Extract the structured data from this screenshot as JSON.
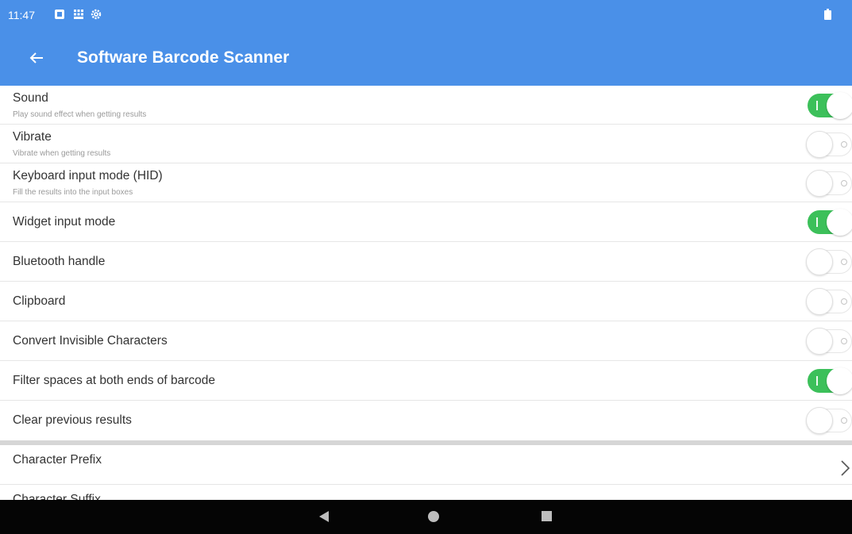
{
  "status_bar": {
    "time": "11:47",
    "icons": [
      "notification-icon",
      "grid-icon",
      "settings-gear-icon",
      "battery-icon"
    ]
  },
  "app_bar": {
    "title": "Software Barcode Scanner",
    "back_icon": "arrow-left-icon",
    "background": "#4a90e8"
  },
  "settings": [
    {
      "title": "Sound",
      "subtitle": "Play sound effect when getting results",
      "enabled": true
    },
    {
      "title": "Vibrate",
      "subtitle": "Vibrate when getting results",
      "enabled": false
    },
    {
      "title": "Keyboard input mode (HID)",
      "subtitle": "Fill the results into the input boxes",
      "enabled": false
    },
    {
      "title": "Widget input mode",
      "enabled": true
    },
    {
      "title": "Bluetooth handle",
      "enabled": false
    },
    {
      "title": "Clipboard",
      "enabled": false
    },
    {
      "title": "Convert Invisible Characters",
      "enabled": false
    },
    {
      "title": "Filter spaces at both ends of barcode",
      "enabled": true
    },
    {
      "title": "Clear previous results",
      "enabled": false
    }
  ],
  "nav_items": [
    {
      "title": "Character Prefix",
      "icon": "chevron-right-icon"
    },
    {
      "title": "Character Suffix",
      "icon": "chevron-right-icon"
    }
  ],
  "system_nav": {
    "buttons": [
      "nav-back-icon",
      "nav-home-icon",
      "nav-recents-icon"
    ]
  },
  "colors": {
    "accent": "#4a90e8",
    "toggle_on": "#3cc05a",
    "divider": "#d6d6d6"
  }
}
